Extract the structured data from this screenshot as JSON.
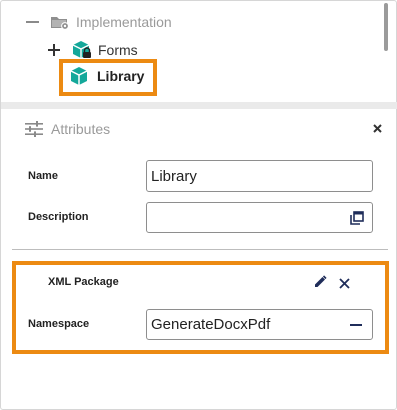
{
  "tree": {
    "items": [
      {
        "label": "Implementation",
        "toggle": "minus",
        "icon": "folder-gear-icon"
      },
      {
        "label": "Forms",
        "toggle": "plus",
        "icon": "package-lock-icon"
      },
      {
        "label": "Library",
        "selected": true,
        "icon": "package-icon"
      }
    ]
  },
  "attributes": {
    "title": "Attributes",
    "name_label": "Name",
    "name_value": "Library",
    "description_label": "Description",
    "description_value": "",
    "xml_package": {
      "title": "XML Package",
      "namespace_label": "Namespace",
      "namespace_value": "GenerateDocxPdf"
    }
  },
  "colors": {
    "highlight": "#ec8a12",
    "package_icon": "#14a89a",
    "icon_dark": "#1f2d5a"
  }
}
